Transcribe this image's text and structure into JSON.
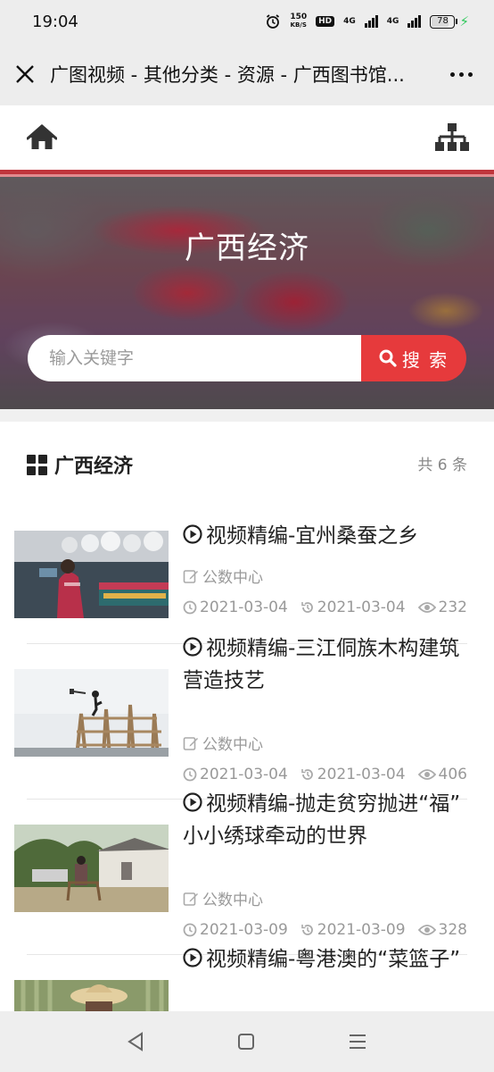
{
  "status_bar": {
    "time": "19:04",
    "speed_value": "150",
    "speed_unit": "KB/S",
    "hd_label": "HD",
    "net1": "4G",
    "net2": "4G",
    "battery": "78",
    "icons": [
      "alarm-icon",
      "signal-icon",
      "battery-icon",
      "charging-icon"
    ]
  },
  "title_bar": {
    "title": "广图视频 - 其他分类 - 资源 - 广西图书馆..."
  },
  "banner": {
    "title": "广西经济",
    "search_placeholder": "输入关键字",
    "search_label": "搜 索"
  },
  "section": {
    "title": "广西经济",
    "count": "共 6 条"
  },
  "items": [
    {
      "title": "视频精编-宜州桑蚕之乡",
      "source": "公数中心",
      "created": "2021-03-04",
      "updated": "2021-03-04",
      "views": "232"
    },
    {
      "title": "视频精编-三江侗族木构建筑营造技艺",
      "source": "公数中心",
      "created": "2021-03-04",
      "updated": "2021-03-04",
      "views": "406"
    },
    {
      "title": "视频精编-抛走贫穷抛进“福” 小小绣球牵动的世界",
      "source": "公数中心",
      "created": "2021-03-09",
      "updated": "2021-03-09",
      "views": "328"
    },
    {
      "title": "视频精编-粤港澳的“菜篮子”"
    }
  ],
  "colors": {
    "accent_red": "#e03c3e",
    "header_line": "#c0353c"
  }
}
